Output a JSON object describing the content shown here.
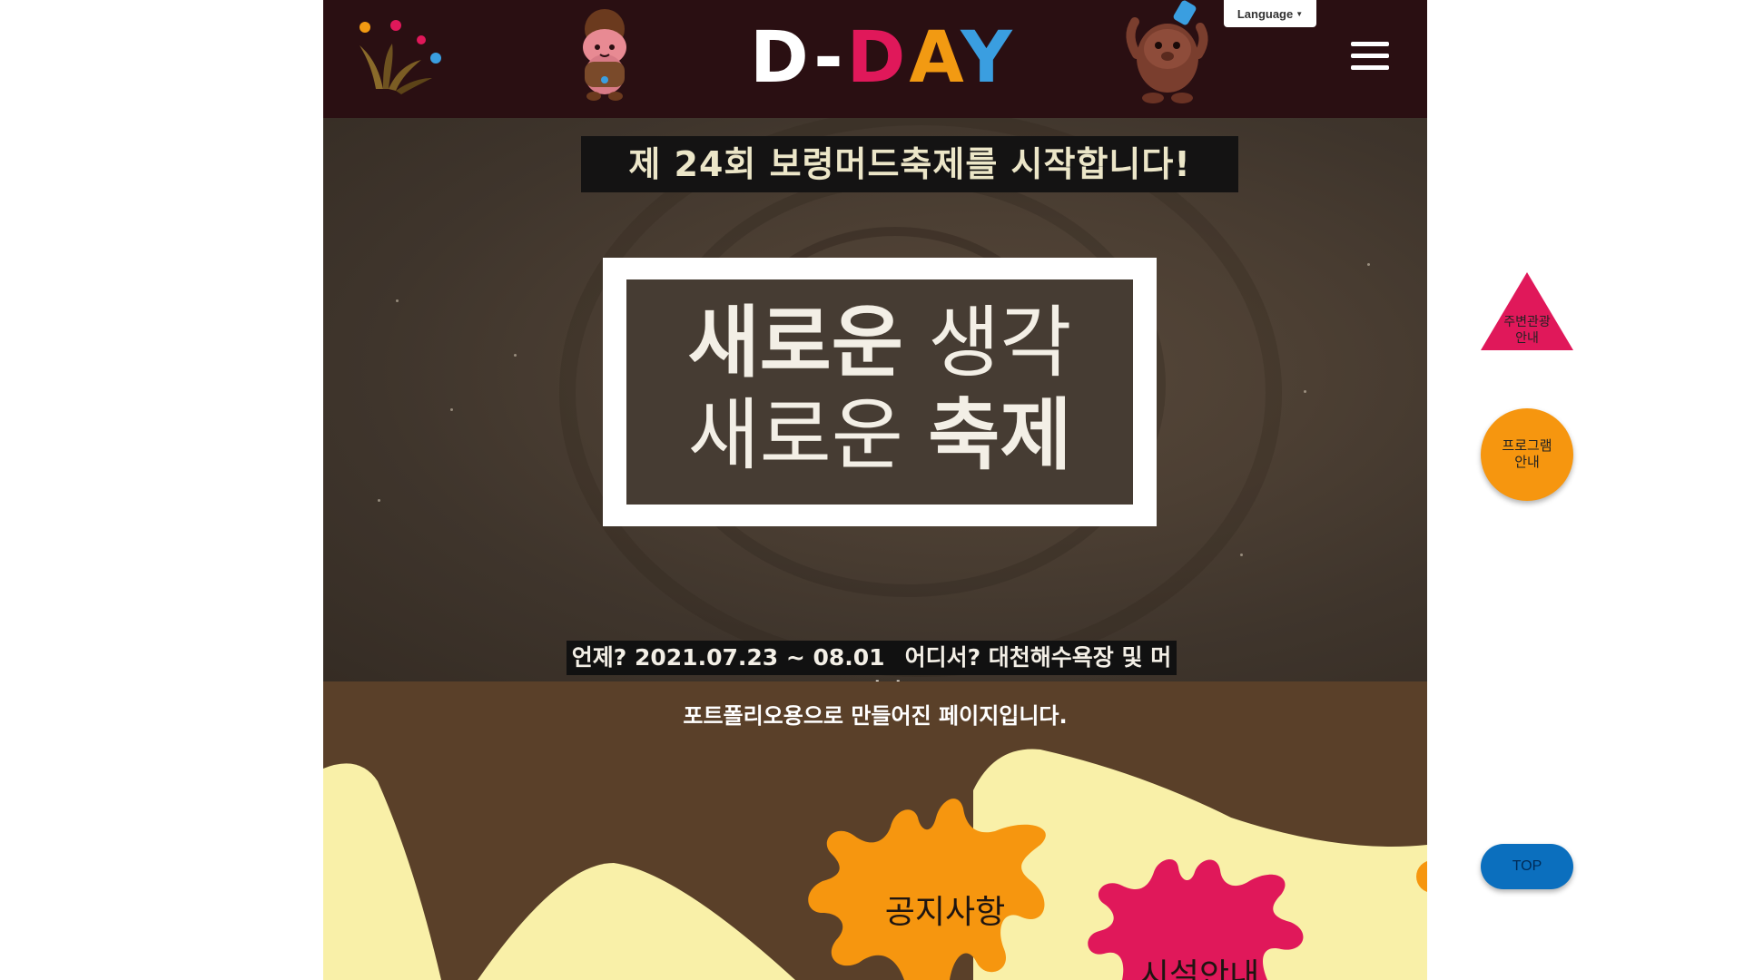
{
  "header": {
    "language_label": "Language",
    "logo_title": {
      "part1": "D-",
      "part2": "D",
      "part3": "A",
      "part4": "Y"
    }
  },
  "hero": {
    "banner_top": "제 24회 보령머드축제를 시작합니다!",
    "frame": {
      "line1_bold": "새로운",
      "line1_thin": " 생각",
      "line2_thin": "새로운 ",
      "line2_bold": "축제"
    },
    "banner_bottom": {
      "when": "언제? 2021.07.23 ~ 08.01",
      "where": "어디서? 대천해수욕장 및 머드광장"
    }
  },
  "content": {
    "notice": "포트폴리오용으로 만들어진 페이지입니다.",
    "splat_1": "공지사항",
    "splat_2": "시설안내"
  },
  "side": {
    "tourism_line1": "주변관광",
    "tourism_line2": "안내",
    "program_line1": "프로그램",
    "program_line2": "안내",
    "top": "TOP"
  },
  "colors": {
    "header_bg": "#2a0f12",
    "content_bg": "#5a4029",
    "sand": "#f9f0a8",
    "pink": "#e0185a",
    "orange": "#f29a12",
    "blue": "#0b6fbe"
  },
  "icons": [
    "festival-logo-icon",
    "mascot-girl-icon",
    "mascot-mud-icon",
    "hamburger-menu-icon",
    "caret-down-icon"
  ]
}
